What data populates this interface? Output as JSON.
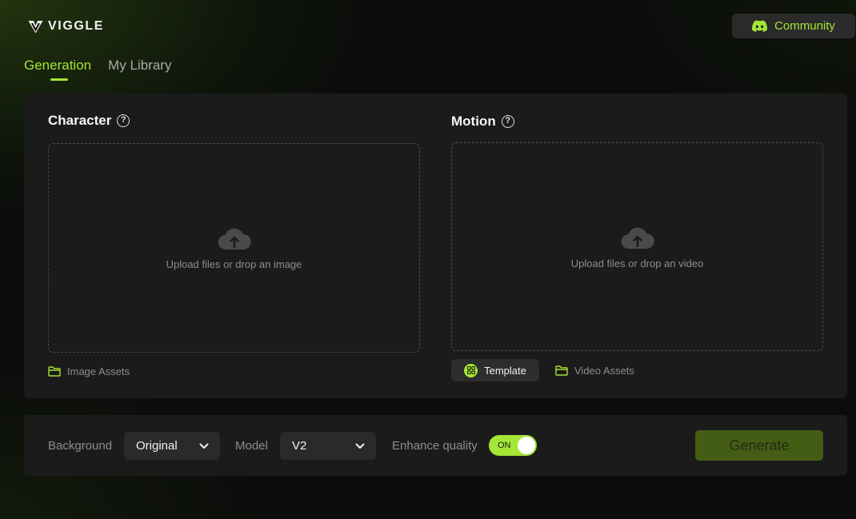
{
  "app": {
    "logo_text": "VIGGLE",
    "accent_color": "#a4e635"
  },
  "header": {
    "community_label": "Community",
    "community_icon": "discord-icon"
  },
  "tabs": [
    {
      "label": "Generation",
      "active": true
    },
    {
      "label": "My Library",
      "active": false
    }
  ],
  "character": {
    "title": "Character",
    "help_icon_text": "?",
    "upload_text": "Upload files or drop an image",
    "assets_label": "Image Assets"
  },
  "motion": {
    "title": "Motion",
    "help_icon_text": "?",
    "upload_text": "Upload files or drop an video",
    "template_label": "Template",
    "assets_label": "Video Assets"
  },
  "settings": {
    "background_label": "Background",
    "background_value": "Original",
    "model_label": "Model",
    "model_value": "V2",
    "enhance_label": "Enhance quality",
    "enhance_toggle_text": "ON",
    "enhance_on": true,
    "generate_label": "Generate"
  }
}
